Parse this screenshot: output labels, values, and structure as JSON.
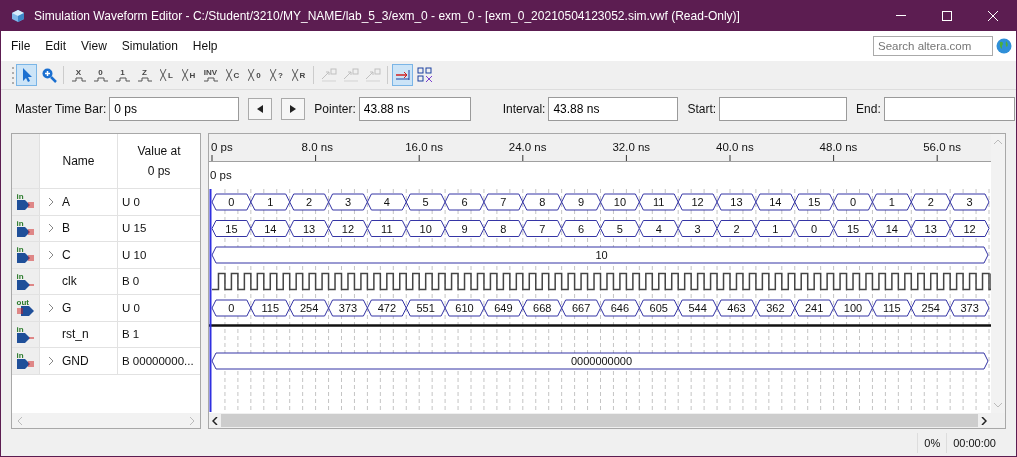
{
  "window": {
    "title": "Simulation Waveform Editor - C:/Student/3210/MY_NAME/lab_5_3/exm_0 - exm_0 - [exm_0_20210504123052.sim.vwf (Read-Only)]"
  },
  "menu": [
    "File",
    "Edit",
    "View",
    "Simulation",
    "Help"
  ],
  "search": {
    "placeholder": "Search altera.com"
  },
  "toolbar": [
    [
      {
        "kind": "select",
        "selected": true,
        "disabled": false
      },
      {
        "kind": "zoom",
        "selected": false,
        "disabled": false
      }
    ],
    [
      {
        "kind": "value",
        "label": "X",
        "selected": false,
        "disabled": false
      },
      {
        "kind": "value",
        "label": "0",
        "selected": false,
        "disabled": false
      },
      {
        "kind": "value",
        "label": "1",
        "selected": false,
        "disabled": false
      },
      {
        "kind": "value",
        "label": "Z",
        "selected": false,
        "disabled": false
      },
      {
        "kind": "bus",
        "label": "L",
        "selected": false,
        "disabled": false
      },
      {
        "kind": "bus",
        "label": "H",
        "selected": false,
        "disabled": false
      },
      {
        "kind": "value",
        "label": "INV",
        "selected": false,
        "disabled": false
      },
      {
        "kind": "bus",
        "label": "C",
        "selected": false,
        "disabled": false
      },
      {
        "kind": "bus",
        "label": "0",
        "selected": false,
        "disabled": false
      },
      {
        "kind": "bus",
        "label": "?",
        "selected": false,
        "disabled": false
      },
      {
        "kind": "bus",
        "label": "R",
        "selected": false,
        "disabled": false
      }
    ],
    [
      {
        "kind": "node",
        "selected": false,
        "disabled": true
      },
      {
        "kind": "node",
        "selected": false,
        "disabled": true
      },
      {
        "kind": "node",
        "selected": false,
        "disabled": true
      }
    ],
    [
      {
        "kind": "grid",
        "selected": true,
        "disabled": false
      },
      {
        "kind": "arrange",
        "selected": false,
        "disabled": false
      }
    ]
  ],
  "time_bar": {
    "master_label": "Master Time Bar:",
    "master": "0 ps",
    "pointer_label": "Pointer:",
    "pointer": "43.88 ns",
    "interval_label": "Interval:",
    "interval": "43.88 ns",
    "start_label": "Start:",
    "end_label": "End:"
  },
  "columns": {
    "name": "Name",
    "value_at": "Value at",
    "value_time": "0 ps"
  },
  "signals": [
    {
      "pin": "in",
      "bus": true,
      "expanded": false,
      "name": "A",
      "value": "U 0",
      "wave": {
        "kind": "bus",
        "values": [
          "0",
          "1",
          "2",
          "3",
          "4",
          "5",
          "6",
          "7",
          "8",
          "9",
          "10",
          "11",
          "12",
          "13",
          "14",
          "15",
          "0",
          "1",
          "2",
          "3"
        ]
      }
    },
    {
      "pin": "in",
      "bus": true,
      "expanded": false,
      "name": "B",
      "value": "U 15",
      "wave": {
        "kind": "bus",
        "values": [
          "15",
          "14",
          "13",
          "12",
          "11",
          "10",
          "9",
          "8",
          "7",
          "6",
          "5",
          "4",
          "3",
          "2",
          "1",
          "0",
          "15",
          "14",
          "13",
          "12"
        ]
      }
    },
    {
      "pin": "in",
      "bus": true,
      "expanded": false,
      "name": "C",
      "value": "U 10",
      "wave": {
        "kind": "constant",
        "label": "10"
      }
    },
    {
      "pin": "in",
      "bus": false,
      "name": "clk",
      "value": "B 0",
      "wave": {
        "kind": "clock"
      }
    },
    {
      "pin": "out",
      "bus": true,
      "expanded": false,
      "name": "G",
      "value": "U 0",
      "wave": {
        "kind": "bus",
        "values": [
          "0",
          "115",
          "254",
          "373",
          "472",
          "551",
          "610",
          "649",
          "668",
          "667",
          "646",
          "605",
          "544",
          "463",
          "362",
          "241",
          "100",
          "115",
          "254",
          "373"
        ]
      }
    },
    {
      "pin": "in",
      "bus": false,
      "name": "rst_n",
      "value": "B 1",
      "wave": {
        "kind": "high"
      }
    },
    {
      "pin": "in",
      "bus": true,
      "expanded": false,
      "name": "GND",
      "value": "B 00000000...",
      "wave": {
        "kind": "constant",
        "label": "0000000000"
      }
    }
  ],
  "timeline": {
    "ticks": [
      "0 ps",
      "8.0 ns",
      "16.0 ns",
      "24.0 ns",
      "32.0 ns",
      "40.0 ns",
      "48.0 ns",
      "56.0 ns"
    ],
    "cursor_label": "0 ps"
  },
  "status_bar": {
    "progress": "0%",
    "elapsed": "00:00:00"
  }
}
